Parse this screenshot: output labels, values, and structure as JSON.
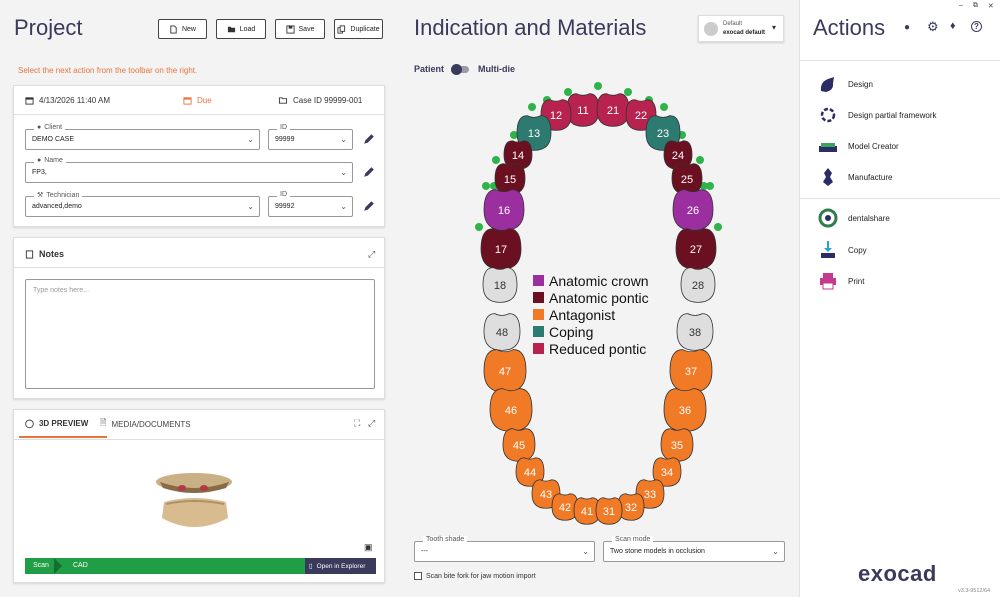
{
  "project": {
    "title": "Project",
    "toolbar": {
      "new": "New",
      "load": "Load",
      "save": "Save",
      "duplicate": "Duplicate"
    },
    "hint": "Select the next action from the toolbar on the right.",
    "date": "4/13/2026 11:40 AM",
    "due": "Due",
    "case_id": "Case ID 99999-001",
    "client": {
      "label": "Client",
      "value": "DEMO CASE",
      "id_label": "ID",
      "id_value": "99999"
    },
    "name": {
      "label": "Name",
      "value": "FP3,"
    },
    "technician": {
      "label": "Technician",
      "value": "advanced,demo",
      "id_label": "ID",
      "id_value": "99992"
    },
    "notes": {
      "title": "Notes",
      "placeholder": "Type notes here..."
    },
    "preview": {
      "tab1": "3D PREVIEW",
      "tab2": "MEDIA/DOCUMENTS",
      "step1": "Scan",
      "step2": "CAD",
      "open": "Open in Explorer"
    }
  },
  "indication": {
    "title": "Indication and Materials",
    "preset_line1": "Default",
    "preset_line2": "exocad default",
    "toggle_left": "Patient",
    "toggle_right": "Multi-die",
    "legend": [
      {
        "label": "Anatomic crown",
        "color": "#9c2fa0"
      },
      {
        "label": "Anatomic pontic",
        "color": "#6b1020"
      },
      {
        "label": "Antagonist",
        "color": "#f07a26"
      },
      {
        "label": "Coping",
        "color": "#2d7a70"
      },
      {
        "label": "Reduced pontic",
        "color": "#b8224e"
      }
    ],
    "teeth_upper": [
      {
        "n": "11",
        "type": "reduced"
      },
      {
        "n": "21",
        "type": "reduced"
      },
      {
        "n": "12",
        "type": "reduced"
      },
      {
        "n": "22",
        "type": "reduced"
      },
      {
        "n": "13",
        "type": "coping"
      },
      {
        "n": "23",
        "type": "coping"
      },
      {
        "n": "14",
        "type": "pontic"
      },
      {
        "n": "24",
        "type": "pontic"
      },
      {
        "n": "15",
        "type": "pontic"
      },
      {
        "n": "25",
        "type": "pontic"
      },
      {
        "n": "16",
        "type": "crown"
      },
      {
        "n": "26",
        "type": "crown"
      },
      {
        "n": "17",
        "type": "pontic"
      },
      {
        "n": "27",
        "type": "pontic"
      },
      {
        "n": "18",
        "type": "none"
      },
      {
        "n": "28",
        "type": "none"
      }
    ],
    "teeth_lower": [
      {
        "n": "48",
        "type": "none"
      },
      {
        "n": "38",
        "type": "none"
      },
      {
        "n": "47",
        "type": "antagonist"
      },
      {
        "n": "37",
        "type": "antagonist"
      },
      {
        "n": "46",
        "type": "antagonist"
      },
      {
        "n": "36",
        "type": "antagonist"
      },
      {
        "n": "45",
        "type": "antagonist"
      },
      {
        "n": "35",
        "type": "antagonist"
      },
      {
        "n": "44",
        "type": "antagonist"
      },
      {
        "n": "34",
        "type": "antagonist"
      },
      {
        "n": "43",
        "type": "antagonist"
      },
      {
        "n": "33",
        "type": "antagonist"
      },
      {
        "n": "42",
        "type": "antagonist"
      },
      {
        "n": "32",
        "type": "antagonist"
      },
      {
        "n": "41",
        "type": "antagonist"
      },
      {
        "n": "31",
        "type": "antagonist"
      }
    ],
    "tooth_shade": {
      "label": "Tooth shade",
      "value": "---"
    },
    "scan_mode": {
      "label": "Scan mode",
      "value": "Two stone models in occlusion"
    },
    "bite_fork": "Scan bite fork for jaw motion import"
  },
  "actions": {
    "title": "Actions",
    "items": [
      "Design",
      "Design partial framework",
      "Model Creator",
      "Manufacture"
    ],
    "items2": [
      "dentalshare",
      "Copy",
      "Print"
    ],
    "brand": "exocad",
    "version": "v3.3-9512/64"
  }
}
